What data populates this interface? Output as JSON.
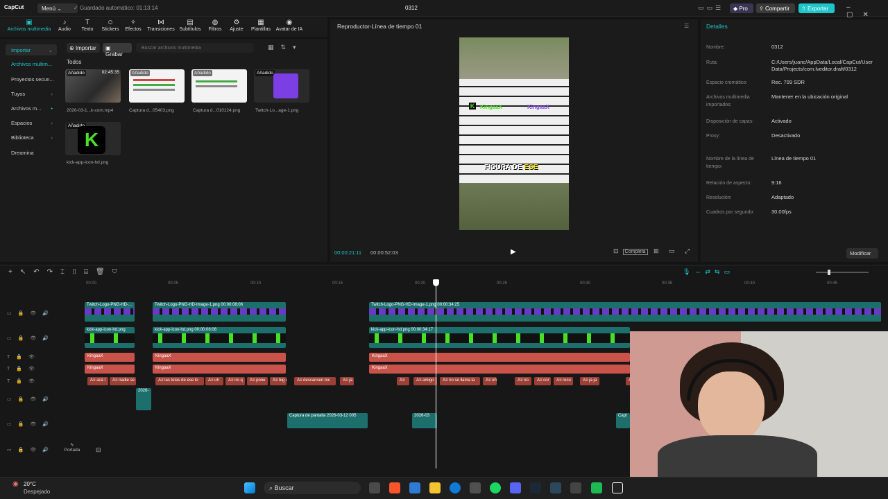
{
  "app": {
    "logo": "CapCut",
    "menu_label": "Menú",
    "autosave": "Guardado automático: 01:13:14",
    "window_title": "0312",
    "pro_label": "Pro",
    "share_label": "Compartir",
    "export_label": "Exportar"
  },
  "toolbar": {
    "items": [
      "Archivos multimedia",
      "Audio",
      "Texto",
      "Stickers",
      "Efectos",
      "Transiciones",
      "Subtítulos",
      "Filtros",
      "Ajuste",
      "Plantillas",
      "Avatar de IA"
    ]
  },
  "media": {
    "sidebar": [
      "Importar",
      "Archivos multim...",
      "Proyectos secun...",
      "Tuyos",
      "Archivos m...",
      "Espacios",
      "Biblioteca",
      "Dreamina"
    ],
    "import_label": "Importar",
    "record_label": "Grabar",
    "search_placeholder": "Buscar archivos multimedia",
    "section": "Todos",
    "items": [
      {
        "label": "2026-03-1...k-com.mp4",
        "badge": "Añadido",
        "duration": "02:45:35"
      },
      {
        "label": "Captura d...05403.png",
        "badge": "Añadido"
      },
      {
        "label": "Captura d...010124.png",
        "badge": "Añadido"
      },
      {
        "label": "Twitch-Lo...age-1.png",
        "badge": "Añadido"
      },
      {
        "label": "kick-app-icon-hd.png",
        "badge": "Añadido"
      }
    ]
  },
  "player": {
    "title": "Reproductor-Línea de tiempo 01",
    "current_time": "00:00:21:11",
    "total_time": "00:00:52:03",
    "overlay_name_1": "KingaaX",
    "overlay_name_2": "KingaaX",
    "caption_white": "FIGURA DE",
    "caption_yellow": "ESE",
    "ratio_label": "Completa"
  },
  "details": {
    "title": "Detalles",
    "rows": [
      {
        "k": "Nombre:",
        "v": "0312"
      },
      {
        "k": "Ruta:",
        "v": "C:/Users/juanc/AppData/Local/CapCut/User Data/Projects/com.lveditor.draft/0312"
      },
      {
        "k": "Espacio cromático:",
        "v": "Rec. 709 SDR"
      },
      {
        "k": "Archivos multimedia importados:",
        "v": "Mantener en la ubicación original"
      },
      {
        "k": "Disposición de capas:",
        "v": "Activado"
      },
      {
        "k": "Proxy:",
        "v": "Desactivado"
      },
      {
        "k": "Nombre de la línea de tiempo:",
        "v": "Línea de tiempo 01"
      },
      {
        "k": "Relación de aspecto:",
        "v": "9:16"
      },
      {
        "k": "Resolución:",
        "v": "Adaptado"
      },
      {
        "k": "Cuadros por segundo:",
        "v": "30.00fps"
      }
    ],
    "modify_label": "Modificar"
  },
  "timeline": {
    "ticks": [
      "00:00",
      "00:05",
      "00:10",
      "00:15",
      "00:20",
      "00:25",
      "00:30",
      "00:35",
      "00:40",
      "00:45"
    ],
    "clips": {
      "tw1": "Twitch-Logo-PNG-HD-...",
      "tw2": "Twitch-Logo-PNG-HD-Image-1.png  00:00:08:06",
      "tw3": "Twitch-Logo-PNG-HD-Image-1.png  00:00:34:25",
      "k1": "kick-app-icon-hd.png",
      "k2": "kick-app-icon-hd.png  00:00:08:06",
      "k3": "kick-app-icon-hd.png  00:00:34:17",
      "text": "KingaaX",
      "subs": [
        "A≡ acá l",
        "A≡ nadie se",
        "A≡ las tetas de ese lo",
        "A≡ uh",
        "A≡ no q",
        "A≡ pone",
        "A≡ big r",
        "A≡ descansen toc",
        "A≡ ja",
        "A≡",
        "A≡ amigo",
        "A≡ no se llama la",
        "A≡ oh",
        "A≡ no",
        "A≡ cor",
        "A≡ recu",
        "A≡ ja ja",
        "A≡"
      ],
      "vid1": "2026-",
      "cap1": "Captura de pantalla 2026-03-12 005",
      "cap2": "2026-03",
      "cap3": "Capt"
    },
    "cover_label": "Portada"
  },
  "taskbar": {
    "temp": "20°C",
    "weather": "Despejado",
    "search": "Buscar"
  }
}
